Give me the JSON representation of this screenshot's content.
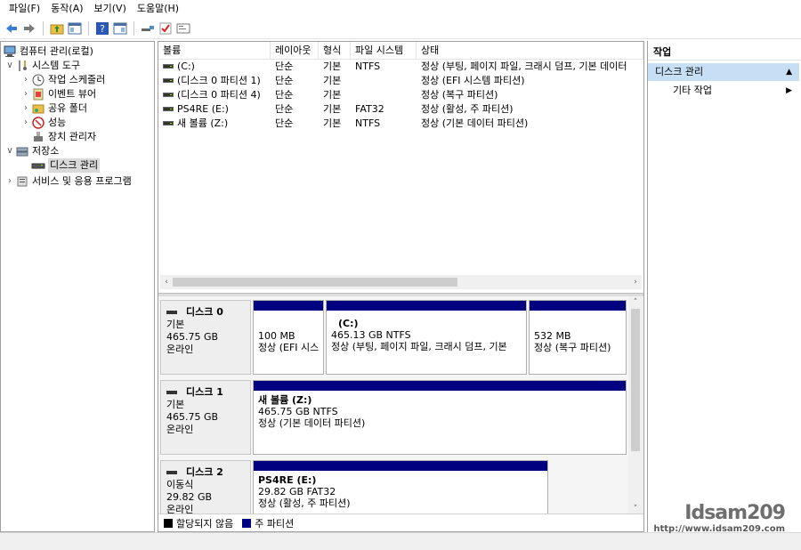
{
  "menubar": {
    "items": [
      "파일(F)",
      "동작(A)",
      "보기(V)",
      "도움말(H)"
    ]
  },
  "toolbar": {
    "buttons": [
      "back-arrow-icon",
      "forward-arrow-icon",
      "folder-up-icon",
      "show-hide-tree-icon",
      "help-icon",
      "properties-icon",
      "connect-icon",
      "check-icon",
      "console-icon"
    ]
  },
  "tree": {
    "root": "컴퓨터 관리(로컬)",
    "system_tools": "시스템 도구",
    "task_scheduler": "작업 스케줄러",
    "event_viewer": "이벤트 뷰어",
    "shared_folders": "공유 폴더",
    "performance": "성능",
    "device_manager": "장치 관리자",
    "storage": "저장소",
    "disk_management": "디스크 관리",
    "services": "서비스 및 응용 프로그램"
  },
  "volumes": {
    "headers": [
      "볼륨",
      "레이아웃",
      "형식",
      "파일 시스템",
      "상태"
    ],
    "rows": [
      {
        "volume": "(C:)",
        "layout": "단순",
        "type": "기본",
        "fs": "NTFS",
        "status": "정상 (부팅, 페이지 파일, 크래시 덤프, 기본 데이터"
      },
      {
        "volume": "(디스크 0 파티션 1)",
        "layout": "단순",
        "type": "기본",
        "fs": "",
        "status": "정상 (EFI 시스템 파티션)"
      },
      {
        "volume": "(디스크 0 파티션 4)",
        "layout": "단순",
        "type": "기본",
        "fs": "",
        "status": "정상 (복구 파티션)"
      },
      {
        "volume": "PS4RE (E:)",
        "layout": "단순",
        "type": "기본",
        "fs": "FAT32",
        "status": "정상 (활성, 주 파티션)"
      },
      {
        "volume": "새 볼륨 (Z:)",
        "layout": "단순",
        "type": "기본",
        "fs": "NTFS",
        "status": "정상 (기본 데이터 파티션)"
      }
    ]
  },
  "disks": [
    {
      "name": "디스크 0",
      "kind": "기본",
      "size": "465.75 GB",
      "state": "온라인",
      "partitions": [
        {
          "title": "",
          "line1": "100 MB",
          "line2": "정상 (EFI 시스"
        },
        {
          "title": "(C:)",
          "line1": "465.13 GB NTFS",
          "line2": "정상 (부팅, 페이지 파일, 크래시 덤프, 기본"
        },
        {
          "title": "",
          "line1": "532 MB",
          "line2": "정상 (복구 파티션)"
        }
      ]
    },
    {
      "name": "디스크 1",
      "kind": "기본",
      "size": "465.75 GB",
      "state": "온라인",
      "partitions": [
        {
          "title": "새 볼륨  (Z:)",
          "line1": "465.75 GB NTFS",
          "line2": "정상 (기본 데이터 파티션)"
        }
      ]
    },
    {
      "name": "디스크 2",
      "kind": "이동식",
      "size": "29.82 GB",
      "state": "온라인",
      "partitions": [
        {
          "title": "PS4RE  (E:)",
          "line1": "29.82 GB FAT32",
          "line2": "정상 (활성, 주 파티션)"
        }
      ]
    }
  ],
  "legend": {
    "unallocated": "할당되지 않음",
    "primary": "주 파티션",
    "unallocated_color": "#000000",
    "primary_color": "#000080"
  },
  "actions": {
    "title": "작업",
    "section": "디스크 관리",
    "more": "기타 작업"
  },
  "watermark": {
    "logo": "Idsam209",
    "url": "http://www.idsam209.com"
  }
}
